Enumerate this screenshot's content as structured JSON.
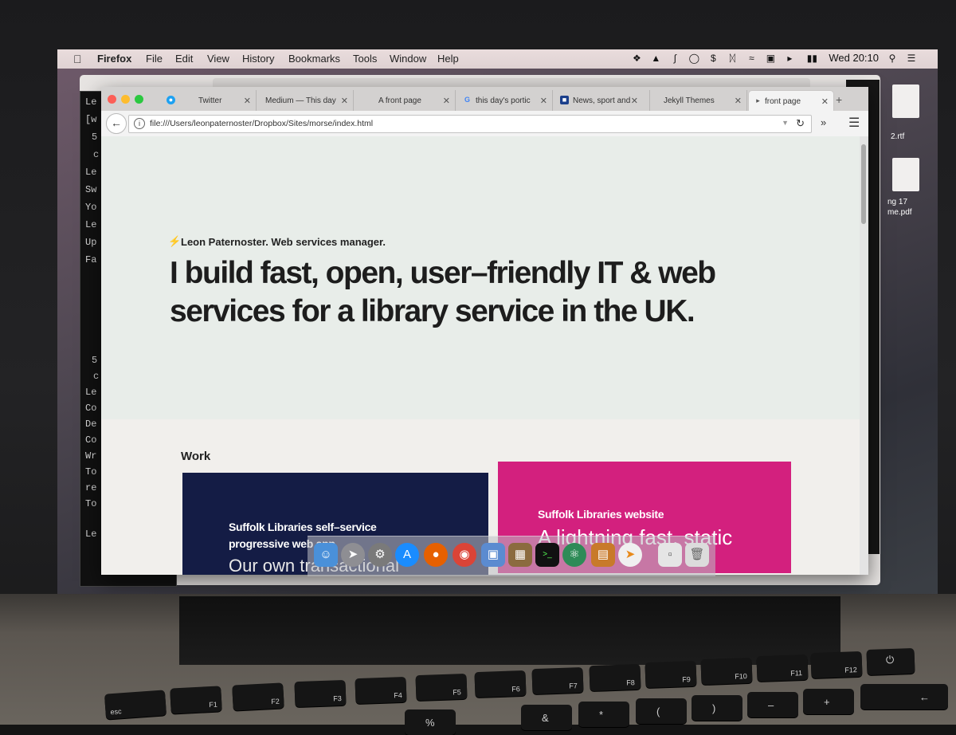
{
  "menubar": {
    "app_name": "Firefox",
    "items": [
      "File",
      "Edit",
      "View",
      "History",
      "Bookmarks",
      "Tools",
      "Window",
      "Help"
    ],
    "clock": "Wed 20:10"
  },
  "terminal": {
    "lines": [
      "Le",
      "[w",
      "5",
      "c",
      "Le",
      "Sw",
      "Yo",
      "Le",
      "Up",
      "Fa",
      "5",
      "c",
      "Le",
      "Co",
      "De",
      "Co",
      "Wr",
      "To",
      "re",
      "To",
      "Le"
    ]
  },
  "desktop": {
    "files": [
      "2.rtf",
      "ng 17",
      "me.pdf"
    ]
  },
  "browser": {
    "tabs": [
      {
        "label": "Twitter"
      },
      {
        "label": "Medium — This day"
      },
      {
        "label": "A front page"
      },
      {
        "label": "this day's portic"
      },
      {
        "label": "News, sport and"
      },
      {
        "label": "Jekyll Themes"
      },
      {
        "label": "front page"
      }
    ],
    "url": "file:///Users/leonpaternoster/Dropbox/Sites/morse/index.html"
  },
  "page": {
    "byline": "Leon Paternoster. Web services manager.",
    "headline": "I build fast, open, user–friendly IT & web services for a library service in the UK.",
    "work_title": "Work",
    "cards": [
      {
        "title": "Suffolk Libraries self–service progressive web app",
        "subtitle": "Our own transactional"
      },
      {
        "title": "Suffolk Libraries website",
        "subtitle": "A lightning fast, static"
      }
    ]
  },
  "colors": {
    "card_navy": "#141c45",
    "card_magenta": "#d3207e",
    "accent_bolt": "#f1b700"
  },
  "keyboard": {
    "keys": [
      "esc",
      "F1",
      "F2",
      "F3",
      "F4",
      "F5",
      "F6",
      "F7",
      "F8",
      "F9",
      "F10",
      "F11",
      "F12"
    ],
    "number_row": [
      "%",
      "&",
      "*",
      "(",
      ")",
      "–",
      "+"
    ]
  }
}
